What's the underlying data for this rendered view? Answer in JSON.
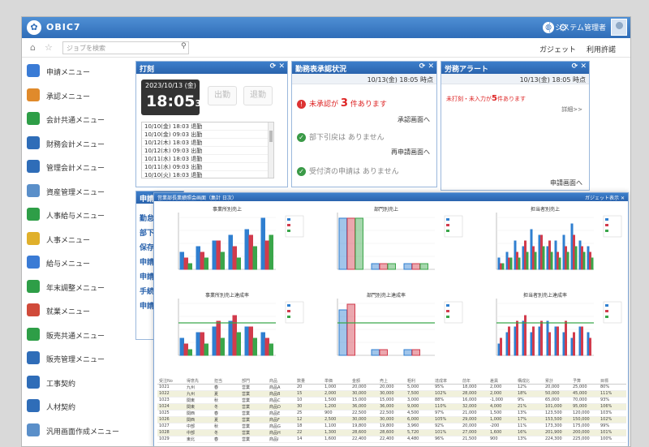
{
  "app": {
    "title": "OBIC7",
    "user": "システム管理者"
  },
  "toolbar": {
    "search_placeholder": "ジョブを検索",
    "gadget_label": "ガジェット",
    "terms_label": "利用許諾"
  },
  "sidebar": {
    "items": [
      {
        "label": "申請メニュー",
        "color": "#3a7bd5"
      },
      {
        "label": "承認メニュー",
        "color": "#e08a2b"
      },
      {
        "label": "会計共通メニュー",
        "color": "#2e9e47"
      },
      {
        "label": "財務会計メニュー",
        "color": "#2f6db8"
      },
      {
        "label": "管理会計メニュー",
        "color": "#2f6db8"
      },
      {
        "label": "資産管理メニュー",
        "color": "#5a8fc9"
      },
      {
        "label": "人事給与メニュー",
        "color": "#2e9e47"
      },
      {
        "label": "人事メニュー",
        "color": "#e0b02b"
      },
      {
        "label": "給与メニュー",
        "color": "#3a7bd5"
      },
      {
        "label": "年末調整メニュー",
        "color": "#2e9e47"
      },
      {
        "label": "就業メニュー",
        "color": "#d04a3a"
      },
      {
        "label": "販売共通メニュー",
        "color": "#2e9e47"
      },
      {
        "label": "販売管理メニュー",
        "color": "#2f6db8"
      },
      {
        "label": "工事契約",
        "color": "#2f6db8"
      },
      {
        "label": "人材契約",
        "color": "#2f6db8"
      },
      {
        "label": "汎用画面作成メニュー",
        "color": "#5a8fc9"
      }
    ]
  },
  "punch": {
    "title": "打刻",
    "date": "2023/10/13 (金)",
    "time": "18:05",
    "seconds": "39",
    "in_label": "出勤",
    "out_label": "退勤",
    "rows": [
      "10/10(金) 18:03 退勤",
      "10/10(金) 09:03 出勤",
      "10/12(木) 18:03 退勤",
      "10/12(木) 09:03 出勤",
      "10/11(水) 18:03 退勤",
      "10/11(水) 09:03 出勤",
      "10/10(火) 18:03 退勤"
    ]
  },
  "approval": {
    "title": "勤務表承認状況",
    "updated": "10/13(金) 18:05 時点",
    "row1_prefix": "未承認が",
    "row1_count": "3",
    "row1_suffix": "件あります",
    "row1_link": "承認画面へ",
    "row2": "部下引戻は ありません",
    "row2_link": "再申請画面へ",
    "row3": "受付済の申請は ありません"
  },
  "alert": {
    "title": "労務アラート",
    "updated": "10/13(金) 18:05 時点",
    "message_prefix": "未打刻・未入力が",
    "message_count": "5",
    "message_suffix": "件あります",
    "detail_link": "詳細>>",
    "bottom_link": "申請画面へ"
  },
  "request": {
    "title": "申請",
    "items": [
      "勤怠",
      "部下",
      "保存",
      "申請",
      "申請",
      "手続",
      "申請"
    ]
  },
  "dashboard": {
    "title": "営業部長業績照会画面（集計 日次）",
    "right_label": "ガジェット表示",
    "charts": [
      {
        "title": "事業所別売上"
      },
      {
        "title": "部門別売上"
      },
      {
        "title": "担当者別売上"
      },
      {
        "title": "事業所別売上達成率"
      },
      {
        "title": "部門別売上達成率"
      },
      {
        "title": "担当者別売上達成率"
      }
    ],
    "table": {
      "headers": [
        "受注No",
        "得意先",
        "担当",
        "部門",
        "商品",
        "数量",
        "単価",
        "金額",
        "売上",
        "粗利",
        "達成率",
        "前年",
        "差異",
        "構成比",
        "累計",
        "予算",
        "目標"
      ],
      "rows": [
        [
          "1021",
          "九州",
          "春",
          "営業",
          "商品A",
          "20",
          "1,000",
          "20,000",
          "20,000",
          "5,000",
          "95%",
          "18,000",
          "2,000",
          "12%",
          "20,000",
          "25,000",
          "80%"
        ],
        [
          "1022",
          "九州",
          "夏",
          "営業",
          "商品B",
          "15",
          "2,000",
          "30,000",
          "30,000",
          "7,500",
          "102%",
          "28,000",
          "2,000",
          "18%",
          "50,000",
          "45,000",
          "111%"
        ],
        [
          "1023",
          "関東",
          "秋",
          "営業",
          "商品C",
          "10",
          "1,500",
          "15,000",
          "15,000",
          "3,000",
          "88%",
          "16,000",
          "-1,000",
          "9%",
          "65,000",
          "70,000",
          "93%"
        ],
        [
          "1024",
          "関東",
          "冬",
          "営業",
          "商品D",
          "30",
          "1,200",
          "36,000",
          "36,000",
          "9,000",
          "110%",
          "32,000",
          "4,000",
          "21%",
          "101,000",
          "95,000",
          "106%"
        ],
        [
          "1025",
          "関西",
          "春",
          "営業",
          "商品E",
          "25",
          "900",
          "22,500",
          "22,500",
          "4,500",
          "97%",
          "21,000",
          "1,500",
          "13%",
          "123,500",
          "120,000",
          "103%"
        ],
        [
          "1026",
          "関西",
          "夏",
          "営業",
          "商品F",
          "12",
          "2,500",
          "30,000",
          "30,000",
          "6,000",
          "105%",
          "29,000",
          "1,000",
          "17%",
          "153,500",
          "150,000",
          "102%"
        ],
        [
          "1027",
          "中部",
          "秋",
          "営業",
          "商品G",
          "18",
          "1,100",
          "19,800",
          "19,800",
          "3,960",
          "92%",
          "20,000",
          "-200",
          "11%",
          "173,300",
          "175,000",
          "99%"
        ],
        [
          "1028",
          "中部",
          "冬",
          "営業",
          "商品H",
          "22",
          "1,300",
          "28,600",
          "28,600",
          "5,720",
          "101%",
          "27,000",
          "1,600",
          "16%",
          "201,900",
          "200,000",
          "101%"
        ],
        [
          "1029",
          "東北",
          "春",
          "営業",
          "商品I",
          "14",
          "1,600",
          "22,400",
          "22,400",
          "4,480",
          "96%",
          "21,500",
          "900",
          "13%",
          "224,300",
          "225,000",
          "100%"
        ]
      ]
    }
  }
}
